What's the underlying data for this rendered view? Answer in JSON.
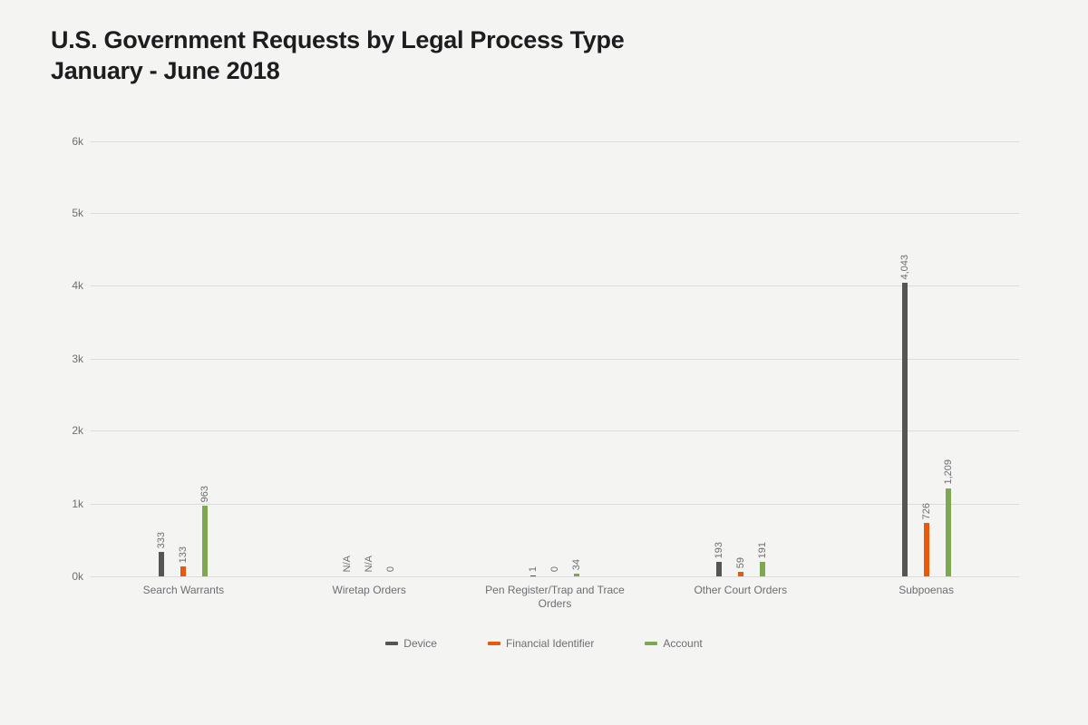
{
  "title_line1": "U.S. Government Requests by Legal Process Type",
  "title_line2": "January - June 2018",
  "chart_data": {
    "type": "bar",
    "categories": [
      "Search Warrants",
      "Wiretap Orders",
      "Pen Register/Trap and Trace Orders",
      "Other Court Orders",
      "Subpoenas"
    ],
    "series": [
      {
        "name": "Device",
        "color": "#555555",
        "values": [
          333,
          null,
          1,
          193,
          4043
        ],
        "labels": [
          "333",
          "N/A",
          "1",
          "193",
          "4,043"
        ]
      },
      {
        "name": "Financial Identifier",
        "color": "#e8590c",
        "values": [
          133,
          null,
          0,
          59,
          726
        ],
        "labels": [
          "133",
          "N/A",
          "0",
          "59",
          "726"
        ]
      },
      {
        "name": "Account",
        "color": "#7fa650",
        "values": [
          963,
          0,
          34,
          191,
          1209
        ],
        "labels": [
          "963",
          "0",
          "34",
          "191",
          "1,209"
        ]
      }
    ],
    "yticks": [
      0,
      1000,
      2000,
      3000,
      4000,
      5000,
      6000
    ],
    "ytick_labels": [
      "0k",
      "1k",
      "2k",
      "3k",
      "4k",
      "5k",
      "6k"
    ],
    "ylim": [
      0,
      6000
    ],
    "xlabel": "",
    "ylabel": "",
    "title": "U.S. Government Requests by Legal Process Type January - June 2018"
  }
}
